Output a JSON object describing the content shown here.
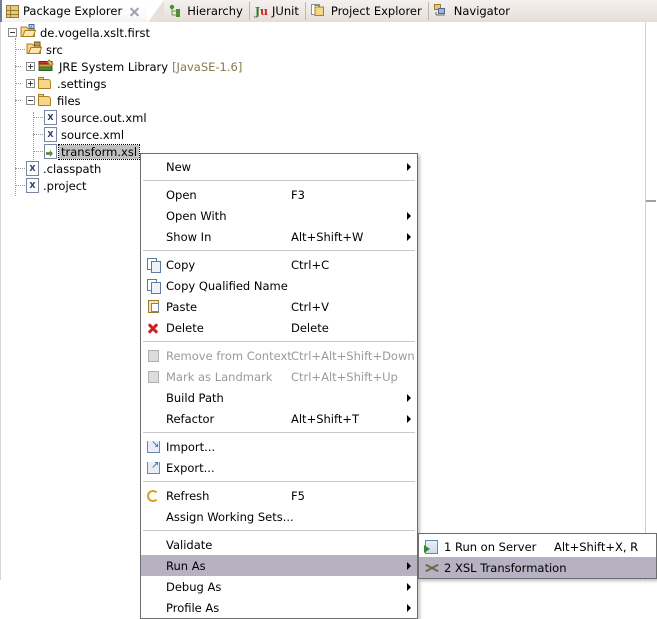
{
  "tabs": [
    {
      "label": "Package Explorer",
      "icon": "package-explorer-icon",
      "active": true,
      "closable": true
    },
    {
      "label": "Hierarchy",
      "icon": "hierarchy-icon",
      "active": false,
      "closable": false
    },
    {
      "label": "JUnit",
      "icon": "junit-icon",
      "active": false,
      "closable": false
    },
    {
      "label": "Project Explorer",
      "icon": "project-explorer-icon",
      "active": false,
      "closable": false
    },
    {
      "label": "Navigator",
      "icon": "navigator-icon",
      "active": false,
      "closable": false
    }
  ],
  "tree": [
    {
      "label": "de.vogella.xslt.first",
      "suffix": "",
      "icon": "java-project-icon",
      "expander": "expanded",
      "depth": 0
    },
    {
      "label": "src",
      "suffix": "",
      "icon": "source-folder-icon",
      "expander": "none",
      "depth": 1
    },
    {
      "label": "JRE System Library",
      "suffix": "[JavaSE-1.6]",
      "icon": "jre-library-icon",
      "expander": "collapsed",
      "depth": 1
    },
    {
      "label": ".settings",
      "suffix": "",
      "icon": "folder-icon",
      "expander": "collapsed",
      "depth": 1
    },
    {
      "label": "files",
      "suffix": "",
      "icon": "folder-icon",
      "expander": "expanded",
      "depth": 1
    },
    {
      "label": "source.out.xml",
      "suffix": "",
      "icon": "xml-file-icon",
      "expander": "none",
      "depth": 2
    },
    {
      "label": "source.xml",
      "suffix": "",
      "icon": "xml-file-icon",
      "expander": "none",
      "depth": 2
    },
    {
      "label": "transform.xsl",
      "suffix": "",
      "icon": "xsl-file-icon",
      "expander": "none",
      "depth": 2,
      "selected": true
    },
    {
      "label": ".classpath",
      "suffix": "",
      "icon": "xml-file-icon",
      "expander": "none",
      "depth": 1
    },
    {
      "label": ".project",
      "suffix": "",
      "icon": "xml-file-icon",
      "expander": "none",
      "depth": 1
    }
  ],
  "context_menu": [
    {
      "type": "item",
      "label": "New",
      "accel": "",
      "icon": "",
      "submenu": true,
      "disabled": false
    },
    {
      "type": "separator"
    },
    {
      "type": "item",
      "label": "Open",
      "accel": "F3",
      "icon": "",
      "submenu": false,
      "disabled": false
    },
    {
      "type": "item",
      "label": "Open With",
      "accel": "",
      "icon": "",
      "submenu": true,
      "disabled": false
    },
    {
      "type": "item",
      "label": "Show In",
      "accel": "Alt+Shift+W",
      "icon": "",
      "submenu": true,
      "disabled": false
    },
    {
      "type": "separator"
    },
    {
      "type": "item",
      "label": "Copy",
      "accel": "Ctrl+C",
      "icon": "copy-icon",
      "submenu": false,
      "disabled": false
    },
    {
      "type": "item",
      "label": "Copy Qualified Name",
      "accel": "",
      "icon": "copy-qualified-name-icon",
      "submenu": false,
      "disabled": false
    },
    {
      "type": "item",
      "label": "Paste",
      "accel": "Ctrl+V",
      "icon": "paste-icon",
      "submenu": false,
      "disabled": false
    },
    {
      "type": "item",
      "label": "Delete",
      "accel": "Delete",
      "icon": "delete-icon",
      "submenu": false,
      "disabled": false
    },
    {
      "type": "separator"
    },
    {
      "type": "item",
      "label": "Remove from Context",
      "accel": "Ctrl+Alt+Shift+Down",
      "icon": "remove-from-context-icon",
      "submenu": false,
      "disabled": true
    },
    {
      "type": "item",
      "label": "Mark as Landmark",
      "accel": "Ctrl+Alt+Shift+Up",
      "icon": "mark-as-landmark-icon",
      "submenu": false,
      "disabled": true
    },
    {
      "type": "item",
      "label": "Build Path",
      "accel": "",
      "icon": "",
      "submenu": true,
      "disabled": false
    },
    {
      "type": "item",
      "label": "Refactor",
      "accel": "Alt+Shift+T",
      "icon": "",
      "submenu": true,
      "disabled": false
    },
    {
      "type": "separator"
    },
    {
      "type": "item",
      "label": "Import...",
      "accel": "",
      "icon": "import-icon",
      "submenu": false,
      "disabled": false
    },
    {
      "type": "item",
      "label": "Export...",
      "accel": "",
      "icon": "export-icon",
      "submenu": false,
      "disabled": false
    },
    {
      "type": "separator"
    },
    {
      "type": "item",
      "label": "Refresh",
      "accel": "F5",
      "icon": "refresh-icon",
      "submenu": false,
      "disabled": false
    },
    {
      "type": "item",
      "label": "Assign Working Sets...",
      "accel": "",
      "icon": "",
      "submenu": false,
      "disabled": false
    },
    {
      "type": "separator"
    },
    {
      "type": "item",
      "label": "Validate",
      "accel": "",
      "icon": "",
      "submenu": false,
      "disabled": false
    },
    {
      "type": "item",
      "label": "Run As",
      "accel": "",
      "icon": "",
      "submenu": true,
      "disabled": false,
      "highlight": true
    },
    {
      "type": "item",
      "label": "Debug As",
      "accel": "",
      "icon": "",
      "submenu": true,
      "disabled": false
    },
    {
      "type": "item",
      "label": "Profile As",
      "accel": "",
      "icon": "",
      "submenu": true,
      "disabled": false
    }
  ],
  "submenu": {
    "title": "Run As",
    "items": [
      {
        "label": "1 Run on Server",
        "accel": "Alt+Shift+X, R",
        "icon": "run-on-server-icon",
        "highlight": false
      },
      {
        "label": "2 XSL Transformation",
        "accel": "",
        "icon": "xsl-transformation-icon",
        "highlight": true
      }
    ]
  },
  "colors": {
    "menu_highlight": "#b6b2c2",
    "selection": "#c0c0c0",
    "tab_active_border": "#6c7e99",
    "library_suffix": "#8a7a4a",
    "disabled_text": "#9a9a9a"
  }
}
